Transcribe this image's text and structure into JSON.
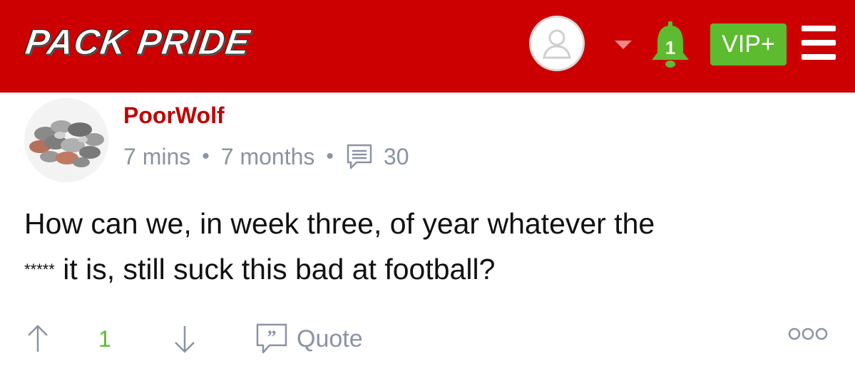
{
  "header": {
    "logo_text": "PACK PRIDE",
    "notifications_count": "1",
    "vip_label": "VIP+",
    "colors": {
      "bar": "#cc0000",
      "vip": "#5dbb2f",
      "bell": "#5dbb2f"
    },
    "icons": [
      "user-avatar-icon",
      "caret-down-icon",
      "bell-icon",
      "hamburger-menu-icon"
    ]
  },
  "post": {
    "author": "PoorWolf",
    "posted_ago": "7 mins",
    "member_for": "7 months",
    "comment_count": "30",
    "body_line1": "How can we, in week three, of year whatever the",
    "body_censored": "*****",
    "body_line2": " it is, still suck this bad at football?",
    "score": "1",
    "quote_label": "Quote",
    "icons": [
      "comment-icon",
      "upvote-arrow-icon",
      "downvote-arrow-icon",
      "quote-icon",
      "more-options-icon"
    ]
  }
}
